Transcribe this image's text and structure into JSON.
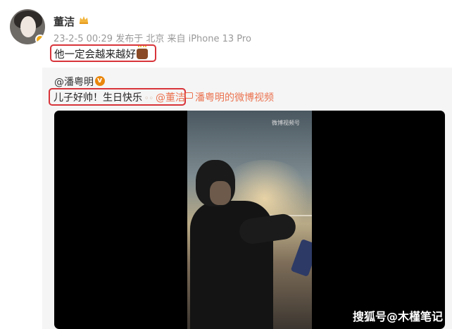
{
  "post": {
    "username": "董洁",
    "meta": "23-2-5 00:29 发布于 北京 来自 iPhone 13 Pro",
    "text": "他一定会越来越好",
    "emoji_icon": "birthday-cake-icon"
  },
  "repost": {
    "username": "@潘粤明",
    "text_main": "儿子好帅！生日快乐",
    "mention": "@董洁",
    "video_link": "潘粤明的微博视频"
  },
  "video": {
    "watermark": "微博视频号",
    "status": "paused"
  },
  "footer": {
    "watermark": "搜狐号@木槿笔记"
  },
  "colors": {
    "highlight_border": "#d8343a",
    "link": "#eb7350",
    "meta": "#999999",
    "repost_bg": "#f5f5f5"
  }
}
